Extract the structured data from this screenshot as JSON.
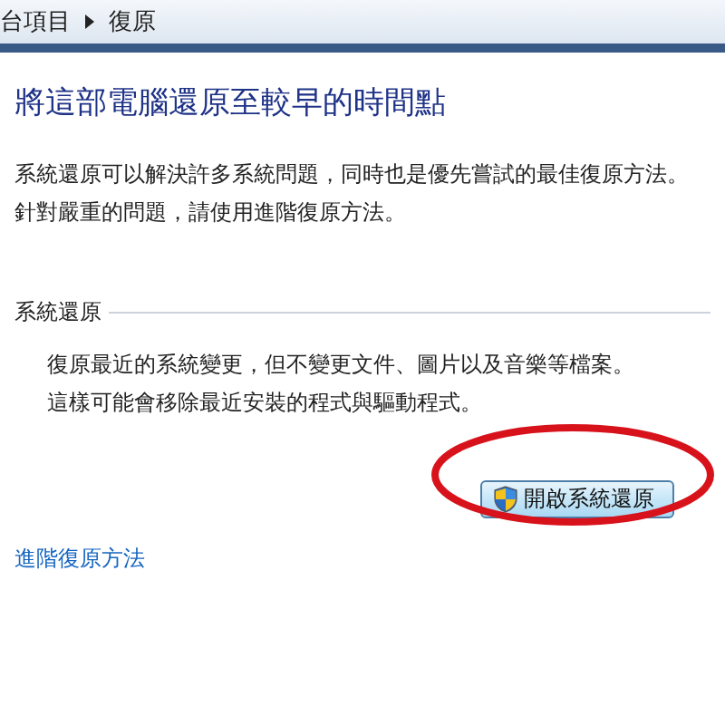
{
  "breadcrumb": {
    "items": [
      "台項目",
      "復原"
    ]
  },
  "title": "將這部電腦還原至較早的時間點",
  "intro": [
    "系統還原可以解決許多系統問題，同時也是優先嘗試的最佳復原方法。",
    "針對嚴重的問題，請使用進階復原方法。"
  ],
  "section": {
    "heading": "系統還原",
    "lines": [
      "復原最近的系統變更，但不變更文件、圖片以及音樂等檔案。",
      "這樣可能會移除最近安裝的程式與驅動程式。"
    ],
    "button": "開啟系統還原"
  },
  "link": "進階復原方法"
}
